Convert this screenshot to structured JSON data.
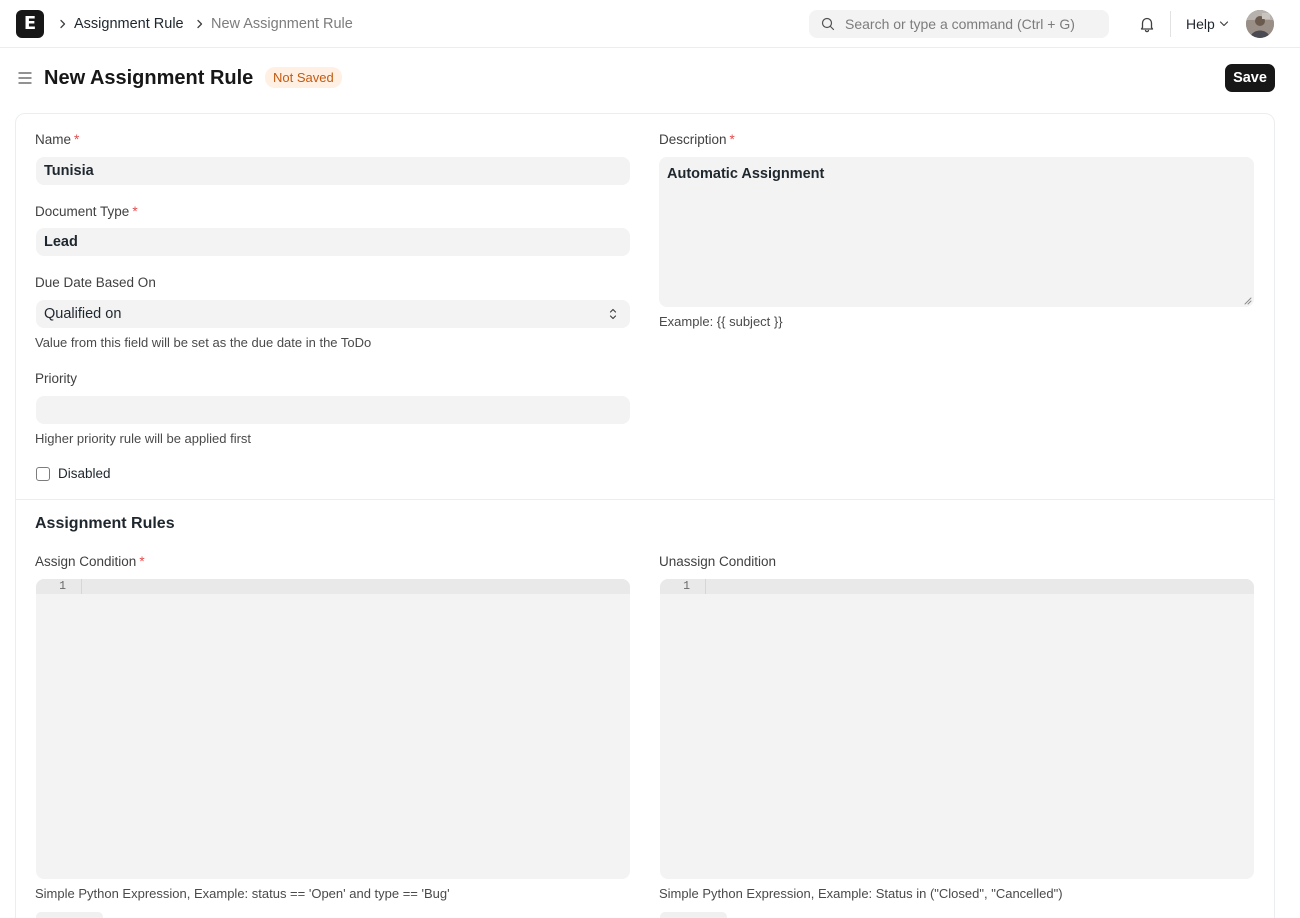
{
  "navbar": {
    "logo_letter": "E",
    "breadcrumbs": [
      "Assignment Rule",
      "New Assignment Rule"
    ],
    "search_placeholder": "Search or type a command (Ctrl + G)",
    "help_label": "Help"
  },
  "page": {
    "title": "New Assignment Rule",
    "status_badge": "Not Saved",
    "save_label": "Save"
  },
  "form": {
    "name": {
      "label": "Name",
      "value": "Tunisia",
      "required": true
    },
    "document_type": {
      "label": "Document Type",
      "value": "Lead",
      "required": true
    },
    "due_date_based_on": {
      "label": "Due Date Based On",
      "value": "Qualified on",
      "help": "Value from this field will be set as the due date in the ToDo"
    },
    "priority": {
      "label": "Priority",
      "value": "",
      "help": "Higher priority rule will be applied first"
    },
    "disabled": {
      "label": "Disabled",
      "checked": false
    },
    "description": {
      "label": "Description",
      "value": "Automatic Assignment",
      "required": true,
      "help": "Example: {{ subject }}"
    },
    "required_marker": "*"
  },
  "assignment_rules": {
    "section_title": "Assignment Rules",
    "assign_condition": {
      "label": "Assign Condition",
      "required": true,
      "line_number": "1",
      "help": "Simple Python Expression, Example: status == 'Open' and type == 'Bug'"
    },
    "unassign_condition": {
      "label": "Unassign Condition",
      "line_number": "1",
      "help": "Simple Python Expression, Example: Status in (\"Closed\", \"Cancelled\")"
    }
  },
  "colors": {
    "primary": "#171717",
    "badge_bg": "#fff0e3",
    "badge_text": "#c45a10",
    "required": "#e24c4c",
    "field_bg": "#f3f3f3"
  },
  "icons": [
    "logo-icon",
    "chevron-right-icon",
    "search-icon",
    "bell-icon",
    "chevron-down-icon",
    "avatar",
    "sidebar-toggle-icon",
    "select-arrows-icon"
  ]
}
